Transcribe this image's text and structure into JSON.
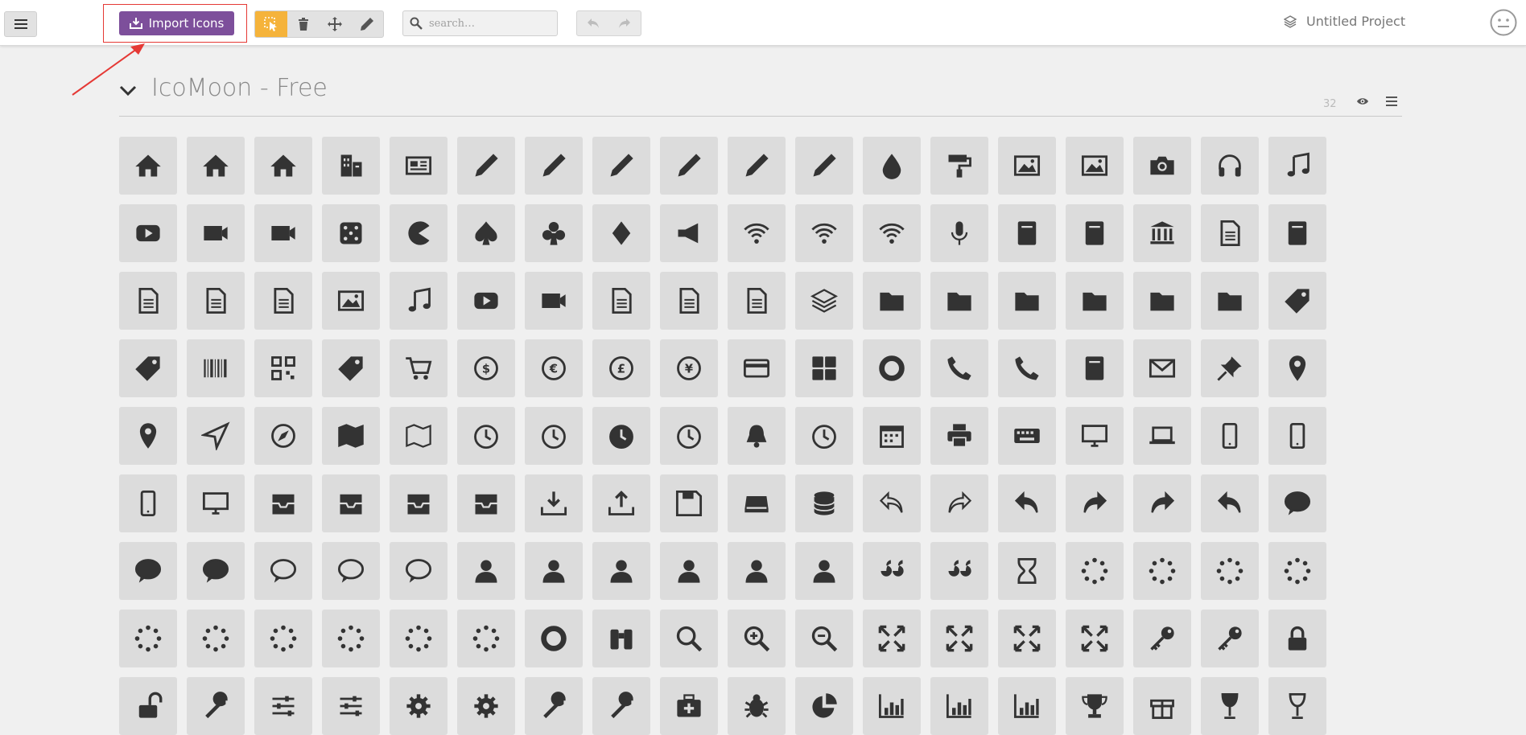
{
  "toolbar": {
    "import_label": "Import Icons",
    "search_placeholder": "search…",
    "project_name": "Untitled Project"
  },
  "section": {
    "title": "IcoMoon - Free",
    "count": "32"
  },
  "colors": {
    "accent": "#7d4f9b",
    "tool_active": "#f5b33b",
    "cell_bg": "#dcdcdc",
    "icon": "#333333",
    "highlight": "#e53935"
  },
  "icons": [
    "home",
    "home2",
    "home3",
    "office",
    "newspaper",
    "pencil",
    "pencil2",
    "quill",
    "pen",
    "blog",
    "eyedropper",
    "droplet",
    "paint-format",
    "image",
    "images",
    "camera",
    "headphones",
    "music",
    "play",
    "film",
    "video-camera",
    "dice",
    "pacman",
    "spades",
    "clubs",
    "diamonds",
    "bullhorn",
    "connection",
    "podcast",
    "feed",
    "mic",
    "book",
    "books",
    "library",
    "file-text",
    "profile",
    "file-empty",
    "files-empty",
    "file-text2",
    "file-picture",
    "file-music",
    "file-play",
    "file-video",
    "file-zip",
    "copy",
    "paste",
    "stack",
    "folder",
    "folder-open",
    "folder-plus",
    "folder-minus",
    "folder-download",
    "folder-upload",
    "price-tag",
    "price-tags",
    "barcode",
    "qrcode",
    "ticket",
    "cart",
    "coin-dollar",
    "coin-euro",
    "coin-pound",
    "coin-yen",
    "credit-card",
    "calculator",
    "lifebuoy",
    "phone",
    "phone-hang-up",
    "address-book",
    "envelop",
    "pushpin",
    "location",
    "location2",
    "compass",
    "compass2",
    "map",
    "map2",
    "history",
    "clock",
    "clock2",
    "alarm",
    "bell",
    "stopwatch",
    "calendar",
    "printer",
    "keyboard",
    "display",
    "laptop",
    "mobile",
    "mobile2",
    "tablet",
    "tv",
    "drawer",
    "drawer2",
    "box-add",
    "box-remove",
    "download",
    "upload",
    "floppy-disk",
    "drive",
    "database",
    "undo",
    "redo",
    "undo2",
    "redo2",
    "forward",
    "reply",
    "bubble",
    "bubbles",
    "bubbles2",
    "bubble2",
    "bubbles3",
    "bubbles4",
    "user",
    "users",
    "user-plus",
    "user-minus",
    "user-check",
    "user-tie",
    "quotes-left",
    "quotes-right",
    "hour-glass",
    "spinner",
    "spinner2",
    "spinner3",
    "spinner4",
    "spinner5",
    "spinner6",
    "spinner7",
    "spinner8",
    "spinner9",
    "spinner10",
    "spinner11",
    "binoculars",
    "search",
    "zoom-in",
    "zoom-out",
    "enlarge",
    "shrink",
    "enlarge2",
    "shrink2",
    "key",
    "key2",
    "lock",
    "unlocked",
    "wrench",
    "equalizer",
    "equalizer2",
    "cog",
    "cogs",
    "hammer",
    "magic-wand",
    "aid-kit",
    "bug",
    "pie-chart",
    "stats-dots",
    "stats-bars",
    "stats-bars2",
    "trophy",
    "gift",
    "glass",
    "glass2"
  ]
}
